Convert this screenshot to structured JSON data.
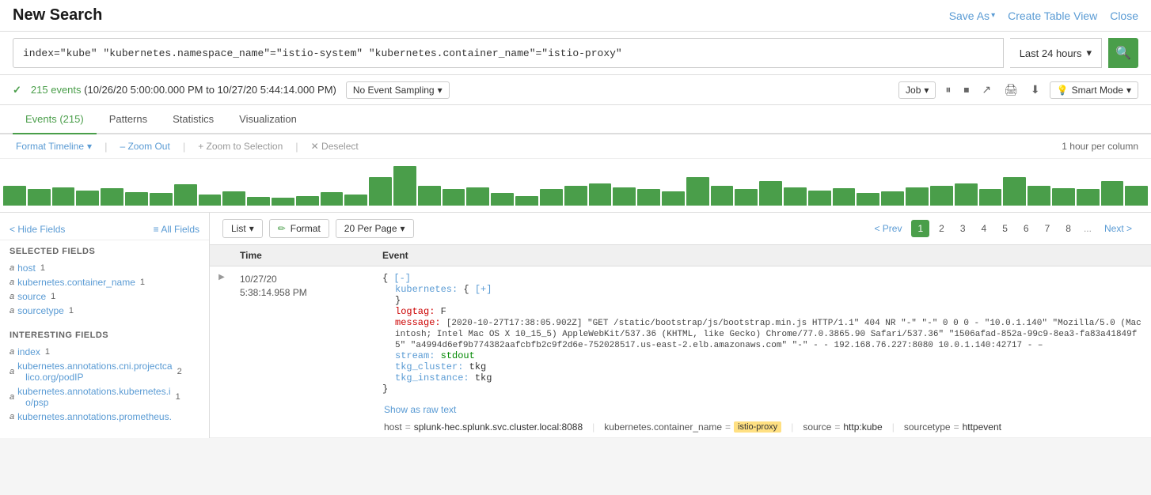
{
  "header": {
    "title": "New Search",
    "save_as": "Save As",
    "create_table_view": "Create Table View",
    "close": "Close"
  },
  "search": {
    "query": "index=\"kube\" \"kubernetes.namespace_name\"=\"istio-system\" \"kubernetes.container_name\"=\"istio-proxy\"",
    "time_range": "Last 24 hours",
    "button_label": "🔍"
  },
  "status": {
    "check": "✓",
    "events_label": "215 events",
    "time_range": "(10/26/20 5:00:00.000 PM to 10/27/20 5:44:14.000 PM)",
    "no_event_sampling": "No Event Sampling",
    "job": "Job",
    "smart_mode": "Smart Mode"
  },
  "toolbar_icons": {
    "pause": "⏸",
    "stop": "⏹",
    "share": "↗",
    "print": "🖨",
    "export": "⬇",
    "bulb": "💡"
  },
  "tabs": [
    {
      "label": "Events (215)",
      "active": true
    },
    {
      "label": "Patterns",
      "active": false
    },
    {
      "label": "Statistics",
      "active": false
    },
    {
      "label": "Visualization",
      "active": false
    }
  ],
  "timeline": {
    "format_label": "Format Timeline",
    "zoom_out": "– Zoom Out",
    "zoom_to_selection": "+ Zoom to Selection",
    "deselect": "✕ Deselect",
    "scale_label": "1 hour per column"
  },
  "chart": {
    "bars": [
      45,
      38,
      42,
      35,
      40,
      30,
      28,
      48,
      25,
      32,
      20,
      18,
      22,
      30,
      25,
      65,
      90,
      45,
      38,
      42,
      28,
      22,
      38,
      45,
      50,
      42,
      38,
      32,
      65,
      45,
      38,
      55,
      42,
      35,
      40,
      28,
      32,
      42,
      45,
      50,
      38,
      65,
      45,
      40,
      38,
      55,
      45
    ]
  },
  "sidebar": {
    "hide_fields": "< Hide Fields",
    "all_fields": "≡ All Fields",
    "selected_title": "SELECTED FIELDS",
    "interesting_title": "INTERESTING FIELDS",
    "selected_fields": [
      {
        "type": "a",
        "name": "host",
        "count": "1"
      },
      {
        "type": "a",
        "name": "kubernetes.container_name",
        "count": "1"
      },
      {
        "type": "a",
        "name": "source",
        "count": "1"
      },
      {
        "type": "a",
        "name": "sourcetype",
        "count": "1"
      }
    ],
    "interesting_fields": [
      {
        "type": "a",
        "name": "index",
        "count": "1"
      },
      {
        "type": "a",
        "name": "kubernetes.annotations.cni.projectcalico.org/podIP",
        "count": "2"
      },
      {
        "type": "a",
        "name": "kubernetes.annotations.kubernetes.io/psp",
        "count": "1"
      },
      {
        "type": "a",
        "name": "kubernetes.annotations.prometheus.",
        "count": ""
      }
    ]
  },
  "pagination": {
    "list_label": "List",
    "format_label": "Format",
    "per_page_label": "20 Per Page",
    "prev": "< Prev",
    "next": "Next >",
    "pages": [
      "1",
      "2",
      "3",
      "4",
      "5",
      "6",
      "7",
      "8"
    ],
    "dots": "...",
    "current_page": "1"
  },
  "table": {
    "col_expand": "",
    "col_time": "Time",
    "col_event": "Event"
  },
  "event": {
    "time_date": "10/27/20",
    "time_clock": "5:38:14.958 PM",
    "json_lines": [
      {
        "indent": 0,
        "text": "{",
        "type": "bracket"
      },
      {
        "indent": 1,
        "key": "[-]",
        "key_type": "link_minus"
      },
      {
        "indent": 2,
        "key": "kubernetes:",
        "val": "{",
        "val_link": "[+]",
        "val_type": "link_plus"
      },
      {
        "indent": 2,
        "text": "}",
        "type": "bracket"
      },
      {
        "indent": 2,
        "key": "logtag:",
        "val": "F",
        "key_type": "red",
        "val_type": "plain"
      },
      {
        "indent": 2,
        "key": "message:",
        "val": "[2020-10-27T17:38:05.902Z] \"GET /static/bootstrap/js/bootstrap.min.js HTTP/1.1\" 404 NR \"-\" \"-\" 0 0 0 - \"10.0.1.140\" \"Mozilla/5.0 (Macintosh; Intel Mac OS X 10_15_5) AppleWebKit/537.36 (KHTML, like Gecko) Chrome/77.0.3865.90 Safari/537.36\" \"1506afad-852a-99c9-8ea3-fa83a41849f5\" \"a4994d6ef9b774382aafcbfb2c9f2d6e-752028517.us-east-2.elb.amazonaws.com\" \"-\" - - 192.168.76.227:8080 10.0.1.140:42717 -",
        "key_type": "red",
        "val_type": "long"
      },
      {
        "indent": 2,
        "key": "stream:",
        "val": "stdout",
        "key_type": "normal",
        "val_type": "green"
      },
      {
        "indent": 2,
        "key": "tkg_cluster:",
        "val": "tkg",
        "key_type": "normal",
        "val_type": "plain"
      },
      {
        "indent": 2,
        "key": "tkg_instance:",
        "val": "tkg",
        "key_type": "normal",
        "val_type": "plain"
      },
      {
        "indent": 0,
        "text": "}",
        "type": "bracket"
      }
    ],
    "show_raw": "Show as raw text",
    "fields_footer": [
      {
        "key": "host",
        "eq": "=",
        "val": "splunk-hec.splunk.svc.cluster.local:8088",
        "highlight": false
      },
      {
        "key": "kubernetes.container_name",
        "eq": "=",
        "val": "istio-proxy",
        "highlight": true
      },
      {
        "key": "source",
        "eq": "=",
        "val": "http:kube",
        "highlight": false
      },
      {
        "key": "sourcetype",
        "eq": "=",
        "val": "httpevent",
        "highlight": false
      }
    ]
  }
}
